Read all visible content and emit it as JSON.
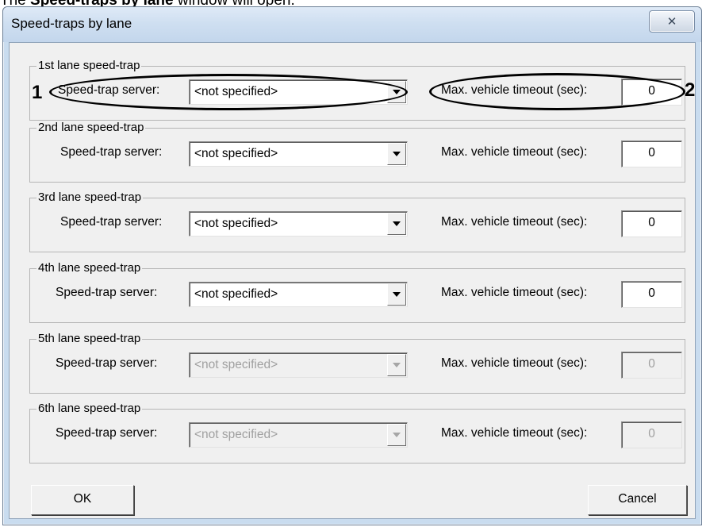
{
  "doc_line": {
    "prefix": "The ",
    "bold": "Speed-traps by lane",
    "suffix": " window will open."
  },
  "window": {
    "title": "Speed-traps by lane",
    "close_symbol": "✕"
  },
  "lanes": [
    {
      "legend": "1st lane speed-trap",
      "server_label": "Speed-trap server:",
      "server_value": "<not specified>",
      "timeout_label": "Max. vehicle timeout (sec):",
      "timeout_value": "0",
      "enabled": true
    },
    {
      "legend": "2nd lane speed-trap",
      "server_label": "Speed-trap server:",
      "server_value": "<not specified>",
      "timeout_label": "Max. vehicle timeout (sec):",
      "timeout_value": "0",
      "enabled": true
    },
    {
      "legend": "3rd lane speed-trap",
      "server_label": "Speed-trap server:",
      "server_value": "<not specified>",
      "timeout_label": "Max. vehicle timeout (sec):",
      "timeout_value": "0",
      "enabled": true
    },
    {
      "legend": "4th lane speed-trap",
      "server_label": "Speed-trap server:",
      "server_value": "<not specified>",
      "timeout_label": "Max. vehicle timeout (sec):",
      "timeout_value": "0",
      "enabled": true
    },
    {
      "legend": "5th lane speed-trap",
      "server_label": "Speed-trap server:",
      "server_value": "<not specified>",
      "timeout_label": "Max. vehicle timeout (sec):",
      "timeout_value": "0",
      "enabled": false
    },
    {
      "legend": "6th lane speed-trap",
      "server_label": "Speed-trap server:",
      "server_value": "<not specified>",
      "timeout_label": "Max. vehicle timeout (sec):",
      "timeout_value": "0",
      "enabled": false
    }
  ],
  "annotations": {
    "marker_1": "1",
    "marker_2": "2"
  },
  "buttons": {
    "ok": "OK",
    "cancel": "Cancel"
  }
}
